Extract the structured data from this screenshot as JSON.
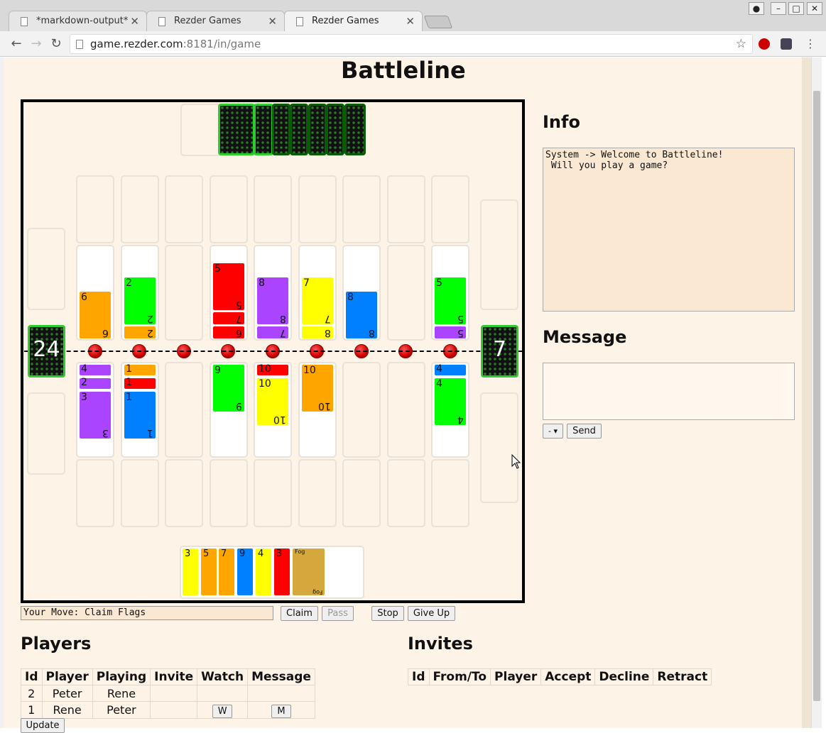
{
  "browser": {
    "tabs": [
      {
        "title": "*markdown-output*"
      },
      {
        "title": "Rezder Games"
      },
      {
        "title": "Rezder Games"
      }
    ],
    "url_host": "game.rezder.com",
    "url_path": ":8181/in/game"
  },
  "page": {
    "title": "Battleline"
  },
  "board": {
    "opp_deck_count": "",
    "left_deck_count": "24",
    "right_deck_count": "7",
    "opp_columns": [
      {
        "cards": [
          {
            "n": "6",
            "color": "#ffa500"
          }
        ]
      },
      {
        "cards": [
          {
            "n": "2",
            "color": "#ffa500"
          },
          {
            "n": "2",
            "color": "#00ff00"
          }
        ]
      },
      {
        "cards": []
      },
      {
        "cards": [
          {
            "n": "6",
            "color": "#ff0000"
          },
          {
            "n": "7",
            "color": "#ff0000"
          },
          {
            "n": "5",
            "color": "#ff0000"
          }
        ]
      },
      {
        "cards": [
          {
            "n": "7",
            "color": "#aa44ff"
          },
          {
            "n": "8",
            "color": "#aa44ff"
          }
        ]
      },
      {
        "cards": [
          {
            "n": "8",
            "color": "#ffff00"
          },
          {
            "n": "7",
            "color": "#ffff00"
          }
        ]
      },
      {
        "cards": [
          {
            "n": "8",
            "color": "#0080ff"
          }
        ]
      },
      {
        "cards": []
      },
      {
        "cards": [
          {
            "n": "5",
            "color": "#aa44ff"
          },
          {
            "n": "5",
            "color": "#00ff00"
          }
        ]
      }
    ],
    "my_columns": [
      {
        "cards": [
          {
            "n": "4",
            "color": "#aa44ff"
          },
          {
            "n": "2",
            "color": "#aa44ff"
          },
          {
            "n": "3",
            "color": "#aa44ff"
          }
        ]
      },
      {
        "cards": [
          {
            "n": "1",
            "color": "#ffa500"
          },
          {
            "n": "1",
            "color": "#ff0000"
          },
          {
            "n": "1",
            "color": "#0080ff"
          }
        ]
      },
      {
        "cards": []
      },
      {
        "cards": [
          {
            "n": "9",
            "color": "#00ff00"
          }
        ]
      },
      {
        "cards": [
          {
            "n": "10",
            "color": "#ff0000"
          },
          {
            "n": "10",
            "color": "#ffff00"
          }
        ]
      },
      {
        "cards": [
          {
            "n": "10",
            "color": "#ffa500"
          }
        ]
      },
      {
        "cards": []
      },
      {
        "cards": []
      },
      {
        "cards": [
          {
            "n": "4",
            "color": "#0080ff"
          },
          {
            "n": "4",
            "color": "#00ff00"
          }
        ]
      }
    ],
    "hand": [
      {
        "n": "3",
        "color": "#ffff00"
      },
      {
        "n": "5",
        "color": "#ffa500"
      },
      {
        "n": "7",
        "color": "#ffa500"
      },
      {
        "n": "9",
        "color": "#0080ff"
      },
      {
        "n": "4",
        "color": "#ffff00"
      },
      {
        "n": "3",
        "color": "#ff0000"
      },
      {
        "n": "Fog",
        "color": "#d4a83c"
      }
    ]
  },
  "controls": {
    "status": "Your Move: Claim Flags",
    "claim": "Claim",
    "pass": "Pass",
    "stop": "Stop",
    "giveup": "Give Up"
  },
  "info": {
    "title": "Info",
    "text": "System -> Welcome to Battleline!\n Will you play a game?"
  },
  "message": {
    "title": "Message",
    "select": "-",
    "send": "Send"
  },
  "players": {
    "title": "Players",
    "headers": [
      "Id",
      "Player",
      "Playing",
      "Invite",
      "Watch",
      "Message"
    ],
    "rows": [
      {
        "id": "2",
        "player": "Peter",
        "playing": "Rene",
        "invite": "",
        "watch": "",
        "message": ""
      },
      {
        "id": "1",
        "player": "Rene",
        "playing": "Peter",
        "invite": "",
        "watch": "W",
        "message": "M"
      }
    ],
    "update": "Update"
  },
  "invites": {
    "title": "Invites",
    "headers": [
      "Id",
      "From/To",
      "Player",
      "Accept",
      "Decline",
      "Retract"
    ]
  }
}
